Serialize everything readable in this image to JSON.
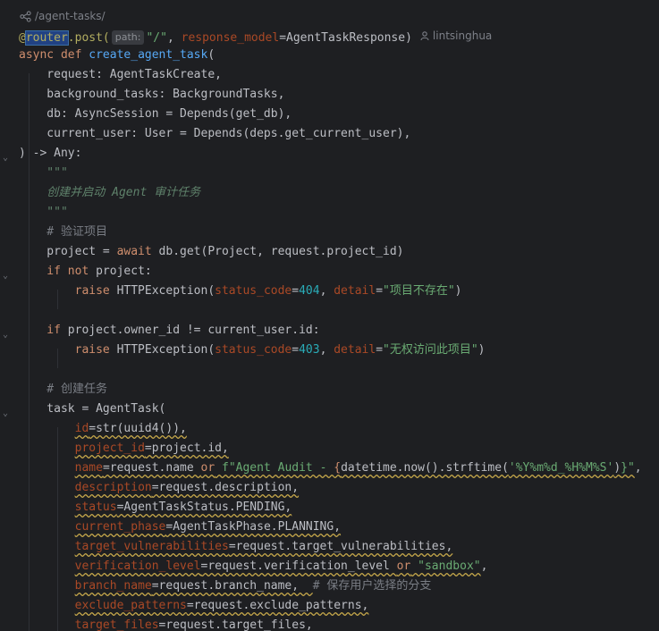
{
  "route_hint": {
    "path": "/agent-tasks/"
  },
  "code": {
    "l1_decorator_prefix": "@",
    "l1_router": "router",
    "l1_post": ".post(",
    "l1_path_badge": "path:",
    "l1_path_value": "\"/\"",
    "l1_comma": ", ",
    "l1_response_model_param": "response_model",
    "l1_response_model_value": "=AgentTaskResponse)",
    "l1_author": "lintsinghua",
    "l2_async": "async def ",
    "l2_fn": "create_agent_task",
    "l2_paren": "(",
    "l3": "    request: AgentTaskCreate,",
    "l4": "    background_tasks: BackgroundTasks,",
    "l5": "    db: AsyncSession = Depends(get_db),",
    "l6": "    current_user: User = Depends(deps.get_current_user),",
    "l7": ") -> Any:",
    "l8": "    \"\"\"",
    "l9": "    创建并启动 Agent 审计任务",
    "l10": "    \"\"\"",
    "l11": "    # 验证项目",
    "l12_a": "    project = ",
    "l12_await": "await",
    "l12_b": " db.get(Project, request.project_id)",
    "l13_if": "    if not",
    "l13_b": " project:",
    "l14_raise": "        raise",
    "l14_b": " HTTPException(",
    "l14_p1": "status_code",
    "l14_eq1": "=",
    "l14_n1": "404",
    "l14_c": ", ",
    "l14_p2": "detail",
    "l14_eq2": "=",
    "l14_s": "\"项目不存在\"",
    "l14_end": ")",
    "l16_if": "    if",
    "l16_b": " project.owner_id != current_user.id:",
    "l17_raise": "        raise",
    "l17_b": " HTTPException(",
    "l17_p1": "status_code",
    "l17_eq1": "=",
    "l17_n1": "403",
    "l17_c": ", ",
    "l17_p2": "detail",
    "l17_eq2": "=",
    "l17_s": "\"无权访问此项目\"",
    "l17_end": ")",
    "l19": "    # 创建任务",
    "l20": "    task = AgentTask(",
    "l21_p": "id",
    "l21_b": "=str(uuid4()),",
    "l22_p": "project_id",
    "l22_b": "=project.id,",
    "l23_p": "name",
    "l23_b": "=request.name ",
    "l23_or": "or",
    "l23_f": " f\"Agent Audit - ",
    "l23_brace": "{",
    "l23_mid": "datetime.now().strftime(",
    "l23_fmt": "'%Y%m%d_%H%M%S'",
    "l23_close": ")",
    "l23_end": "}\"",
    "l23_tail": ",",
    "l24_p": "description",
    "l24_b": "=request.description,",
    "l25_p": "status",
    "l25_b": "=AgentTaskStatus.PENDING,",
    "l26_p": "current_phase",
    "l26_b": "=AgentTaskPhase.PLANNING,",
    "l27_p": "target_vulnerabilities",
    "l27_b": "=request.target_vulnerabilities,",
    "l28_p": "verification_level",
    "l28_b": "=request.verification_level ",
    "l28_or": "or",
    "l28_s": " \"sandbox\"",
    "l28_end": ",",
    "l29_p": "branch_name",
    "l29_b": "=request.branch_name,  ",
    "l29_c": "# 保存用户选择的分支",
    "l30_p": "exclude_patterns",
    "l30_b": "=request.exclude_patterns,",
    "l31_p": "target_files",
    "l31_b": "=request.target_files,"
  },
  "colors": {
    "background": "#1e1f22",
    "keyword": "#cf8e6d",
    "function": "#56a8f5",
    "string": "#6aab73",
    "number": "#2aacb8",
    "parameter": "#aa4926",
    "comment": "#7a7e85",
    "docstring": "#5f826b"
  },
  "icons": {
    "route": "link-route-icon",
    "author": "user-icon",
    "fold": "chevron-fold-icon"
  }
}
